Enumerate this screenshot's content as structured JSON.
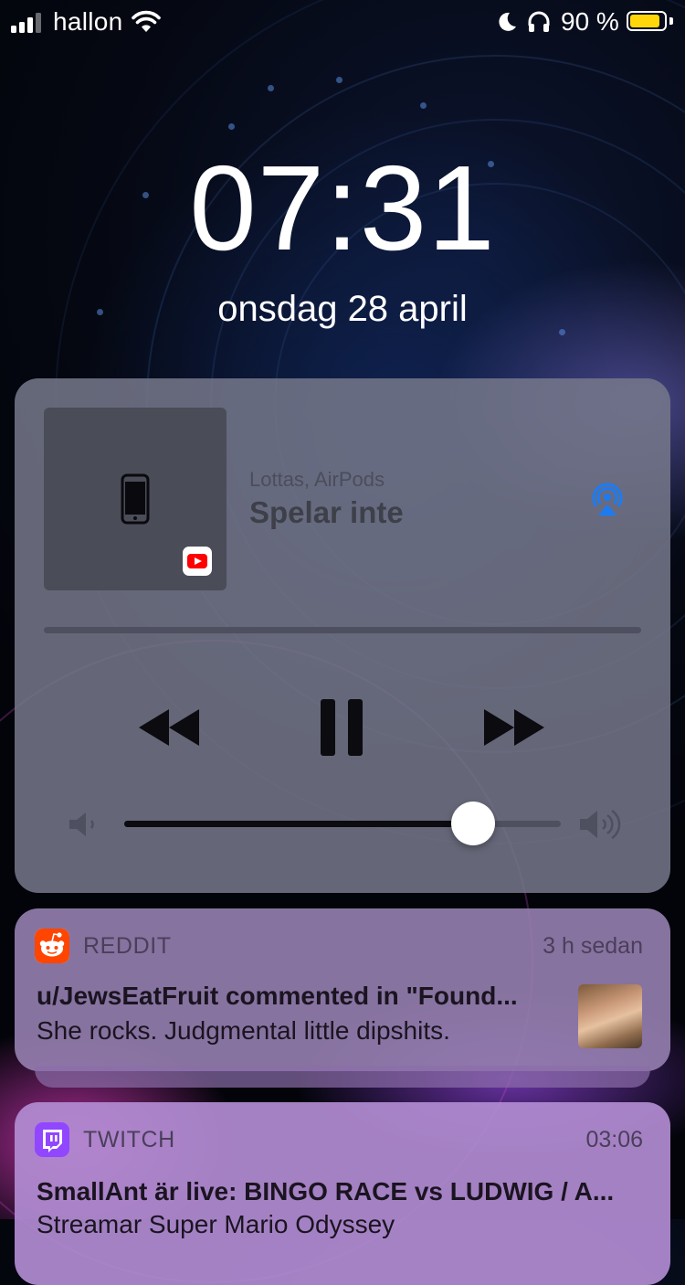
{
  "status_bar": {
    "carrier": "hallon",
    "battery_percent": "90 %",
    "battery_level": 0.9,
    "icons": [
      "signal-bars-icon",
      "wifi-icon",
      "moon-icon",
      "headphones-icon",
      "battery-icon"
    ]
  },
  "lock_screen": {
    "time": "07:31",
    "date": "onsdag 28 april"
  },
  "now_playing": {
    "route": "Lottas, AirPods",
    "title": "Spelar inte",
    "source_app_icon": "youtube-icon",
    "playback_progress": 0,
    "volume_level": 0.8,
    "controls": [
      "rewind-icon",
      "pause-icon",
      "fast-forward-icon"
    ],
    "colors": {
      "airplay": "#1a7cf5"
    }
  },
  "notifications": [
    {
      "app": "REDDIT",
      "time": "3 h sedan",
      "title": "u/JewsEatFruit commented in \"Found...",
      "body": "She rocks. Judgmental little dipshits.",
      "icon": "reddit-icon",
      "color": "#ff4500"
    },
    {
      "app": "TWITCH",
      "time": "03:06",
      "title": "SmallAnt är live: BINGO RACE vs LUDWIG / A...",
      "body": "Streamar Super Mario Odyssey",
      "icon": "twitch-icon",
      "color": "#9146ff"
    }
  ]
}
